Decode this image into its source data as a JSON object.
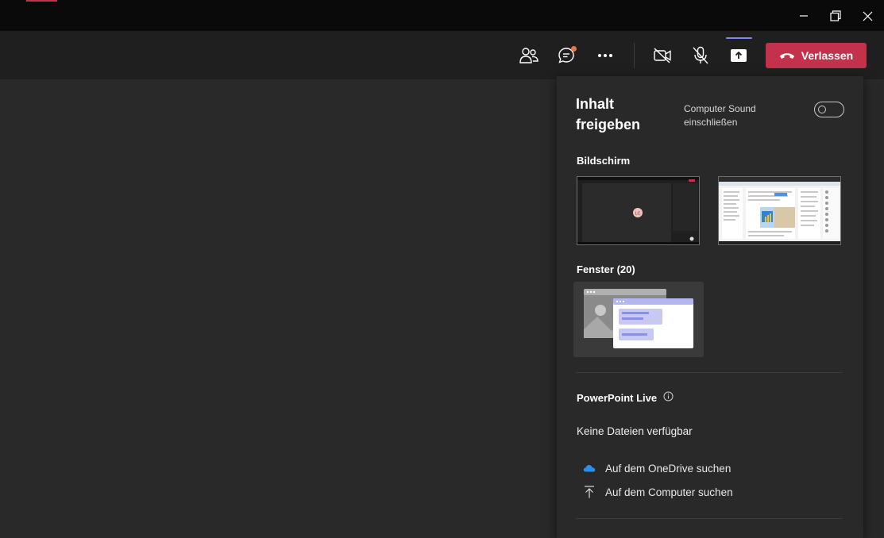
{
  "window": {
    "controls": [
      "minimize-icon",
      "restore-icon",
      "close-icon"
    ]
  },
  "toolbar": {
    "icons": [
      "participants-icon",
      "chat-icon",
      "more-options-icon",
      "camera-off-icon",
      "mic-off-icon",
      "share-content-icon"
    ],
    "leave_label": "Verlassen",
    "leave_color": "#c4314b",
    "notification_color": "#e97548",
    "accent_color": "#7f85f5"
  },
  "share_panel": {
    "title": "Inhalt freigeben",
    "computer_sound_label": "Computer Sound einschließen",
    "computer_sound_on": false,
    "screen_section": "Bildschirm",
    "screen_thumb_avatar": "LC",
    "window_section": "Fenster (20)",
    "powerpoint_section": "PowerPoint Live",
    "no_files_text": "Keine Dateien verfügbar",
    "onedrive_link": "Auf dem OneDrive suchen",
    "computer_link": "Auf dem Computer suchen"
  }
}
